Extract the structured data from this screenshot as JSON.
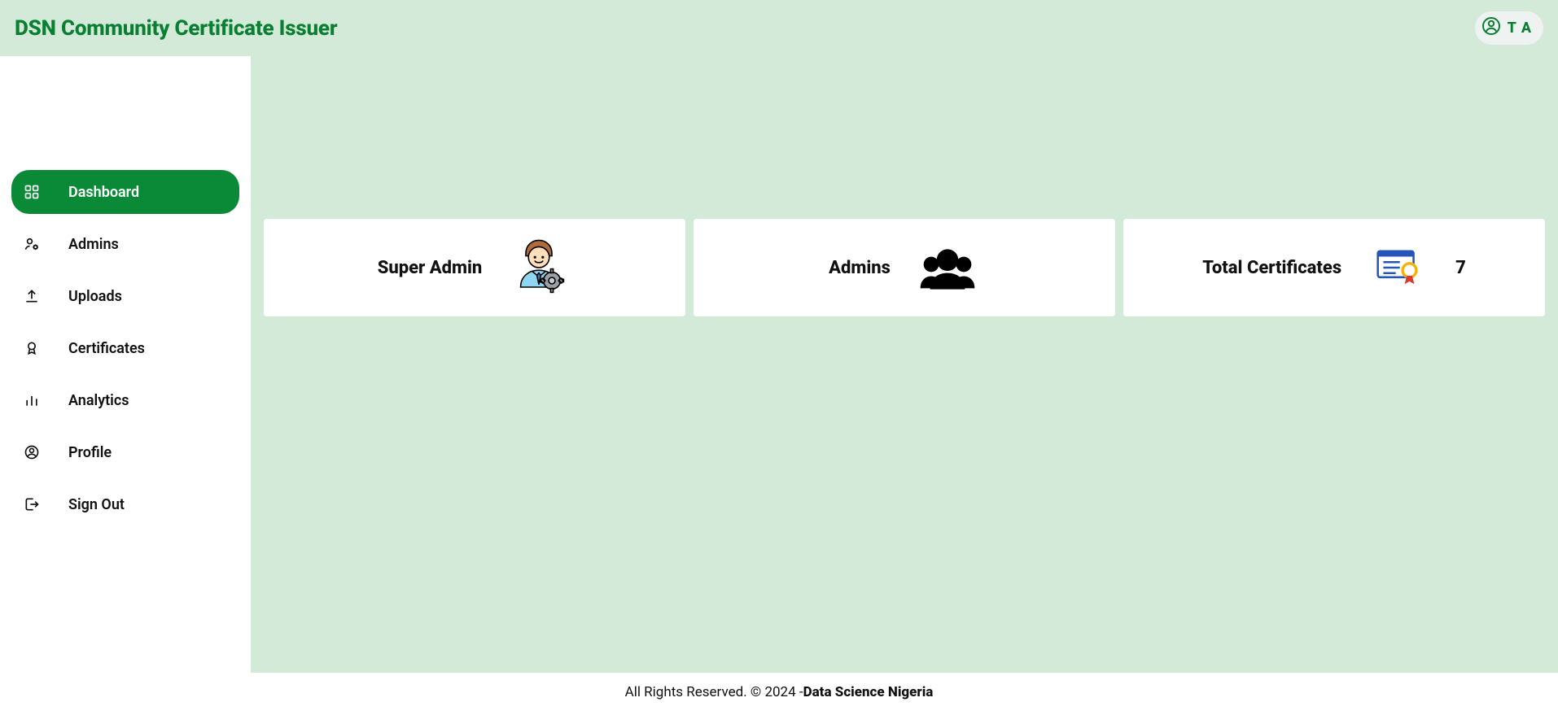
{
  "header": {
    "title": "DSN Community Certificate Issuer",
    "user_initials": "T A"
  },
  "sidebar": {
    "items": [
      {
        "label": "Dashboard",
        "active": true,
        "icon": "dashboard-icon"
      },
      {
        "label": "Admins",
        "active": false,
        "icon": "user-gear-icon"
      },
      {
        "label": "Uploads",
        "active": false,
        "icon": "upload-icon"
      },
      {
        "label": "Certificates",
        "active": false,
        "icon": "badge-icon"
      },
      {
        "label": "Analytics",
        "active": false,
        "icon": "bar-chart-icon"
      },
      {
        "label": "Profile",
        "active": false,
        "icon": "user-circle-icon"
      },
      {
        "label": "Sign Out",
        "active": false,
        "icon": "sign-out-icon"
      }
    ]
  },
  "dashboard": {
    "cards": [
      {
        "title": "Super Admin",
        "icon": "super-admin-icon"
      },
      {
        "title": "Admins",
        "icon": "group-icon"
      },
      {
        "title": "Total Certificates",
        "icon": "certificate-icon",
        "value": "7"
      }
    ]
  },
  "footer": {
    "text_prefix": "All Rights Reserved. © 2024 -",
    "org": "Data Science Nigeria"
  }
}
